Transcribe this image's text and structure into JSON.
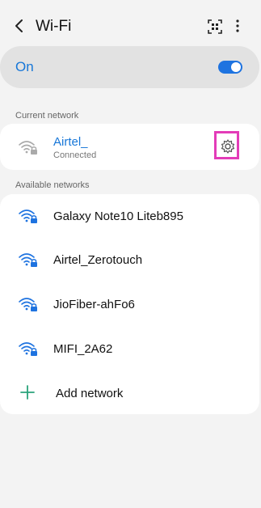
{
  "header": {
    "title": "Wi-Fi",
    "back_icon": "back-arrow-icon",
    "qr_icon": "qr-scan-icon",
    "more_icon": "more-vertical-icon"
  },
  "toggle": {
    "label": "On",
    "state": true,
    "accent_color": "#1e73e0"
  },
  "current_section": {
    "label": "Current network",
    "network": {
      "name": "Airtel_",
      "status": "Connected",
      "settings_icon": "gear-icon",
      "highlight_color": "#e33cb8"
    }
  },
  "available_section": {
    "label": "Available networks",
    "networks": [
      {
        "name": "Galaxy Note10 Liteb895"
      },
      {
        "name": "Airtel_Zerotouch"
      },
      {
        "name": "JioFiber-ahFo6"
      },
      {
        "name": "MIFI_2A62"
      }
    ],
    "add_network_label": "Add network"
  }
}
